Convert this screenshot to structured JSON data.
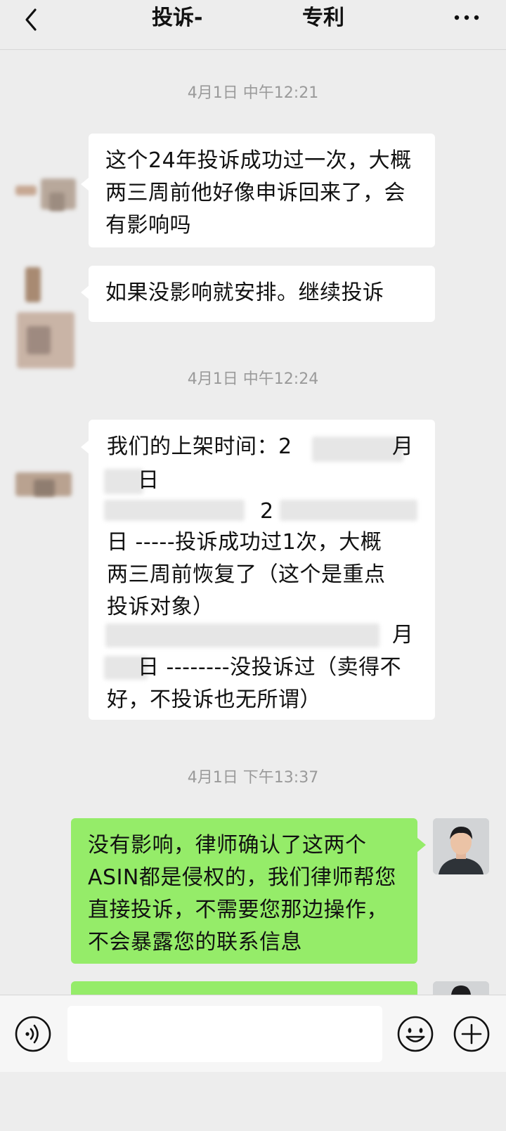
{
  "header": {
    "title_left": "投诉-",
    "title_right": "专利"
  },
  "timestamps": [
    "4月1日 中午12:21",
    "4月1日 中午12:24",
    "4月1日 下午13:37"
  ],
  "messages": {
    "m1": "这个24年投诉成功过一次，大概两三周前他好像申诉回来了，会有影响吗",
    "m2": "如果没影响就安排。继续投诉",
    "m3": {
      "l1": "我们的上架时间：2",
      "l1b": "月",
      "l2": "日",
      "l3": "2",
      "l4": "日 -----投诉成功过1次，大概",
      "l5": "两三周前恢复了（这个是重点",
      "l6": "投诉对象）",
      "l7": "月",
      "l8": "日 --------没投诉过（卖得不",
      "l9": "好，不投诉也无所谓）"
    },
    "m4": "没有影响，律师确认了这两个ASIN都是侵权的，我们律师帮您直接投诉，不需要您那边操作，不会暴露您的联系信息"
  },
  "icons": {
    "back": "back-chevron-icon",
    "more": "more-dots-icon",
    "voice": "voice-icon",
    "emoji": "emoji-icon",
    "plus": "plus-icon"
  },
  "colors": {
    "background": "#ededed",
    "incoming_bubble": "#ffffff",
    "outgoing_bubble": "#95ec69"
  }
}
